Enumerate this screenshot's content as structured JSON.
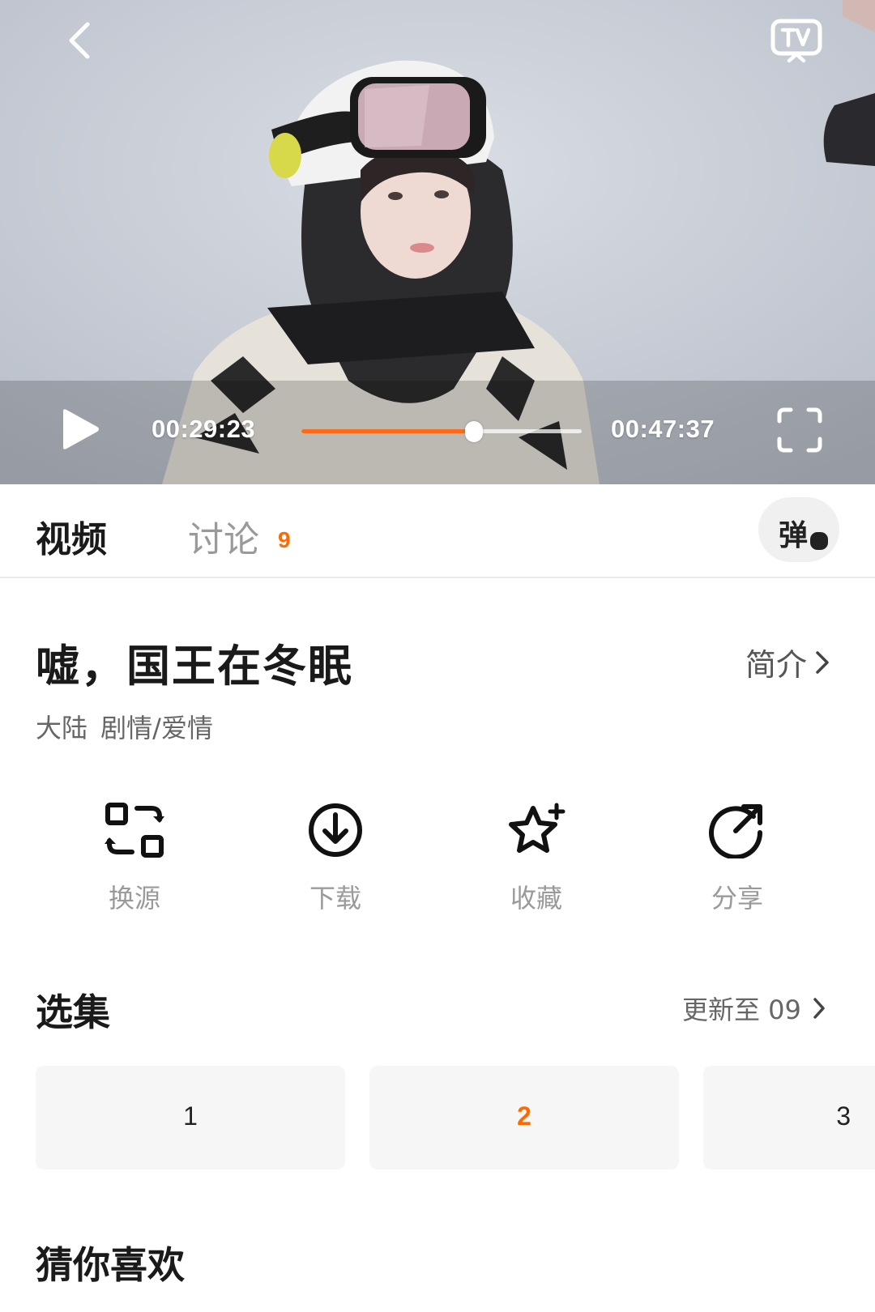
{
  "player": {
    "current_time": "00:29:23",
    "total_time": "00:47:37",
    "progress": 0.615,
    "accent_color": "#ff6a1a"
  },
  "tabs": {
    "video": "视频",
    "discussion": "讨论",
    "discussion_count": "9",
    "danmaku": "弹"
  },
  "show": {
    "title": "嘘，国王在冬眠",
    "intro_label": "简介",
    "meta": "大陆  剧情/爱情"
  },
  "actions": [
    {
      "label": "换源",
      "icon": "switch-source-icon"
    },
    {
      "label": "下载",
      "icon": "download-icon"
    },
    {
      "label": "收藏",
      "icon": "favorite-star-icon"
    },
    {
      "label": "分享",
      "icon": "share-icon"
    }
  ],
  "episodes": {
    "section_title": "选集",
    "update_label": "更新至 09",
    "items": [
      "1",
      "2",
      "3"
    ],
    "active": "2"
  },
  "recommend": {
    "section_title": "猜你喜欢"
  }
}
